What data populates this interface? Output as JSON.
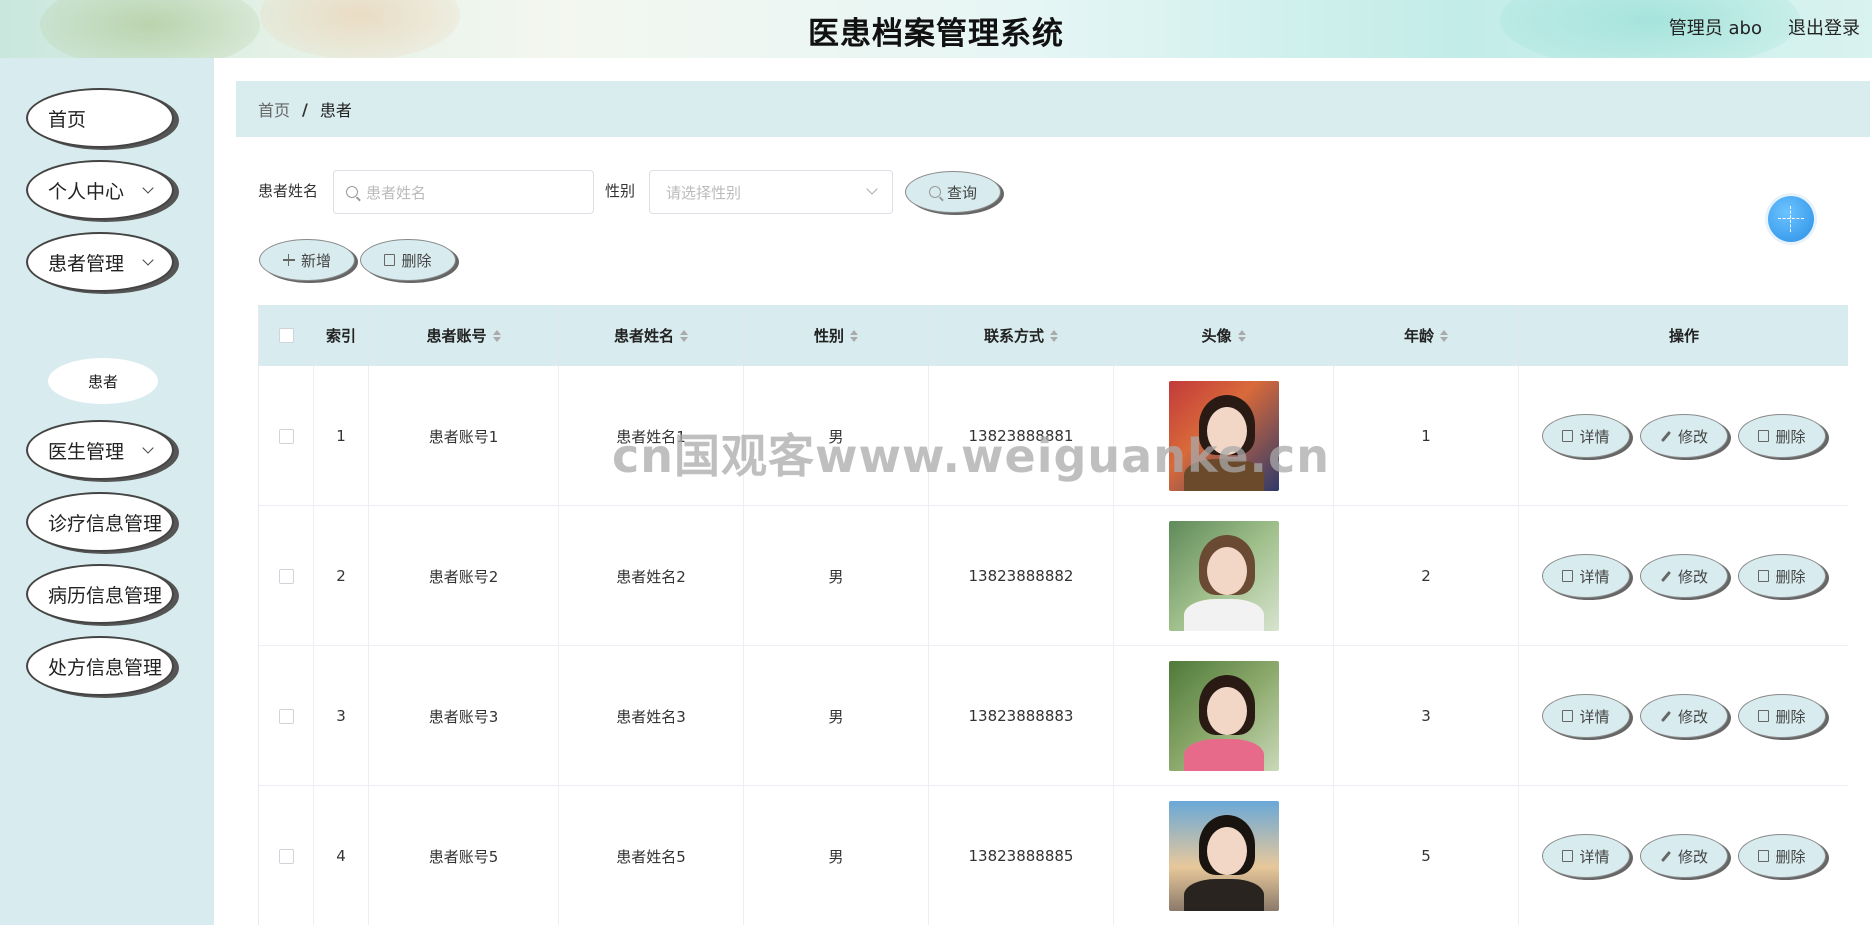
{
  "header": {
    "title": "医患档案管理系统",
    "user": "管理员 abo",
    "logout": "退出登录"
  },
  "sidebar": {
    "items": [
      {
        "label": "首页"
      },
      {
        "label": "个人中心"
      },
      {
        "label": "患者管理"
      },
      {
        "label": "医生管理"
      },
      {
        "label": "诊疗信息管理"
      },
      {
        "label": "病历信息管理"
      },
      {
        "label": "处方信息管理"
      }
    ],
    "sub_item": "患者"
  },
  "breadcrumb": {
    "home": "首页",
    "sep": "/",
    "current": "患者"
  },
  "search": {
    "name_label": "患者姓名",
    "name_placeholder": "患者姓名",
    "gender_label": "性别",
    "gender_placeholder": "请选择性别",
    "query_button": "查询"
  },
  "actions": {
    "add": "新增",
    "delete": "删除"
  },
  "table": {
    "columns": [
      "索引",
      "患者账号",
      "患者姓名",
      "性别",
      "联系方式",
      "头像",
      "年龄",
      "操作"
    ],
    "rows": [
      {
        "index": "1",
        "account": "患者账号1",
        "name": "患者姓名1",
        "gender": "男",
        "phone": "13823888881",
        "age": "1"
      },
      {
        "index": "2",
        "account": "患者账号2",
        "name": "患者姓名2",
        "gender": "男",
        "phone": "13823888882",
        "age": "2"
      },
      {
        "index": "3",
        "account": "患者账号3",
        "name": "患者姓名3",
        "gender": "男",
        "phone": "13823888883",
        "age": "3"
      },
      {
        "index": "4",
        "account": "患者账号5",
        "name": "患者姓名5",
        "gender": "男",
        "phone": "13823888885",
        "age": "5"
      }
    ],
    "op_detail": "详情",
    "op_edit": "修改",
    "op_delete": "删除"
  },
  "watermark": "cn国观客www.weiguanke.cn"
}
